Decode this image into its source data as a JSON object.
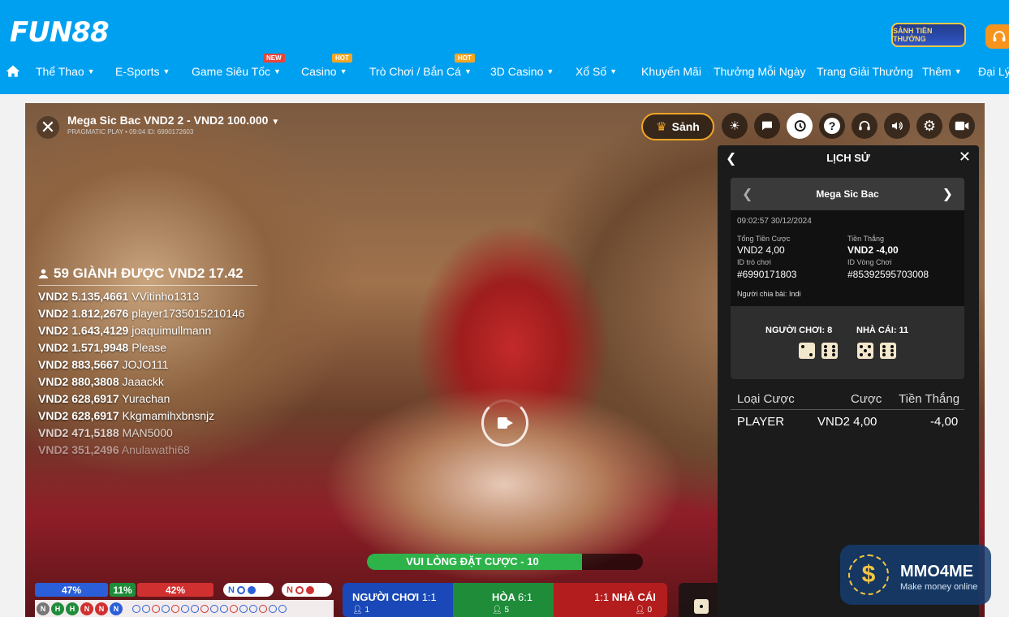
{
  "header": {
    "logo": "FUN88",
    "promo_badge": "SẢNH TIỀN THƯỞNG",
    "nav": [
      {
        "label": "Thể Thao",
        "dropdown": true
      },
      {
        "label": "E-Sports",
        "dropdown": true
      },
      {
        "label": "Game Siêu Tốc",
        "dropdown": true,
        "badge": "NEW"
      },
      {
        "label": "Casino",
        "dropdown": true,
        "badge": "HOT"
      },
      {
        "label": "Trò Chơi / Bắn Cá",
        "dropdown": true,
        "badge": "HOT"
      },
      {
        "label": "3D Casino",
        "dropdown": true
      },
      {
        "label": "Xổ Số",
        "dropdown": true
      },
      {
        "label": "Khuyến Mãi"
      },
      {
        "label": "Thưởng Mỗi Ngày"
      },
      {
        "label": "Trang Giải Thưởng"
      },
      {
        "label": "Thêm",
        "dropdown": true
      },
      {
        "label": "Đại Lý"
      }
    ]
  },
  "game": {
    "title": "Mega Sic Bac VND2 2 - VND2 100.000",
    "subtitle": "PRAGMATIC PLAY • 09:04 ID: 6990172603",
    "lobby_label": "Sảnh",
    "winners": {
      "header": "59 GIÀNH ĐƯỢC VND2 17.42",
      "rows": [
        {
          "amount": "VND2 5.135,4661",
          "player": "VVitinho1313"
        },
        {
          "amount": "VND2 1.812,2676",
          "player": "player1735015210146"
        },
        {
          "amount": "VND2 1.643,4129",
          "player": "joaquimullmann"
        },
        {
          "amount": "VND2 1.571,9948",
          "player": "Please"
        },
        {
          "amount": "VND2 883,5667",
          "player": "JOJO111"
        },
        {
          "amount": "VND2 880,3808",
          "player": "Jaaackk"
        },
        {
          "amount": "VND2 628,6917",
          "player": "Yurachan"
        },
        {
          "amount": "VND2 628,6917",
          "player": "Kkgmamihxbnsnjz"
        },
        {
          "amount": "VND2 471,5188",
          "player": "MAN5000"
        },
        {
          "amount": "VND2 351,2496",
          "player": "Anulawathi68"
        }
      ]
    },
    "countdown": {
      "label": "VUI LÒNG ĐẶT CƯỢC - 10",
      "progress": 0.78
    },
    "stats": {
      "player_pct": "47%",
      "tie_pct": "11%",
      "banker_pct": "42%"
    },
    "road_pill_1": "N",
    "road_pill_2": "N",
    "road_cells": [
      "N",
      "H",
      "H",
      "N",
      "N",
      "N"
    ],
    "bets": {
      "player": {
        "label": "NGƯỜI CHƠI",
        "odds": "1:1",
        "count": "1"
      },
      "tie": {
        "label": "HÒA",
        "odds": "6:1",
        "count": "5"
      },
      "banker": {
        "label": "NHÀ CÁI",
        "odds": "1:1",
        "count": "0"
      }
    }
  },
  "history": {
    "title": "LỊCH SỬ",
    "game_name": "Mega Sic Bac",
    "timestamp": "09:02:57 30/12/2024",
    "total_bet_label": "Tổng Tiền Cược",
    "total_bet": "VND2 4,00",
    "winnings_label": "Tiền Thắng",
    "winnings": "VND2 -4,00",
    "game_id_label": "ID trò chơi",
    "game_id": "#6990171803",
    "round_id_label": "ID Vòng Chơi",
    "round_id": "#85392595703008",
    "dealer_label": "Người chia bài:",
    "dealer": "Indi",
    "player_score": "NGƯỜI CHƠI: 8",
    "banker_score": "NHÀ CÁI: 11",
    "dice": {
      "player": [
        2,
        6
      ],
      "banker": [
        5,
        6
      ]
    },
    "table_headers": {
      "type": "Loại Cược",
      "bet": "Cược",
      "win": "Tiền Thắng"
    },
    "rows": [
      {
        "type": "PLAYER",
        "bet": "VND2 4,00",
        "win": "-4,00"
      }
    ]
  },
  "watermark": {
    "name": "MMO4ME",
    "tagline": "Make money online"
  },
  "colors": {
    "header_blue": "#00a0f0",
    "accent_orange": "#f5a623",
    "player_blue": "#1a48b8",
    "tie_green": "#1f8c3a",
    "banker_red": "#b31d1d"
  }
}
